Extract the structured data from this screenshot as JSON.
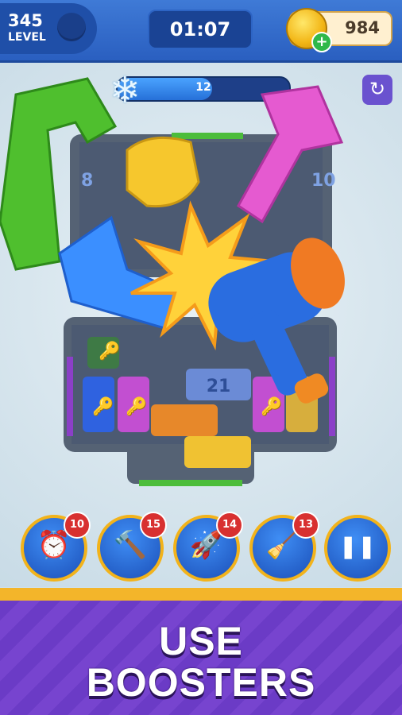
{
  "hud": {
    "level_number": "345",
    "level_label": "LEVEL",
    "timer": "01:07",
    "coins": "984"
  },
  "objective": {
    "remaining": "12",
    "progress": 0.55
  },
  "board_numbers": [
    "8",
    "10",
    "21"
  ],
  "boosters": [
    {
      "name": "clock-booster",
      "icon": "alarm-clock-icon",
      "count": "10",
      "glyph": "⏰"
    },
    {
      "name": "hammer-booster",
      "icon": "hammer-icon",
      "count": "15",
      "glyph": "🔨"
    },
    {
      "name": "rocket-booster",
      "icon": "rocket-icon",
      "count": "14",
      "glyph": "🚀"
    },
    {
      "name": "vacuum-booster",
      "icon": "vacuum-icon",
      "count": "13",
      "glyph": "🧹"
    }
  ],
  "footer": {
    "line1": "USE",
    "line2": "BOOSTERS"
  },
  "colors": {
    "accent": "#f2b31b",
    "hud_blue": "#2a5fc0",
    "footer_purple": "#6b3bc6"
  }
}
